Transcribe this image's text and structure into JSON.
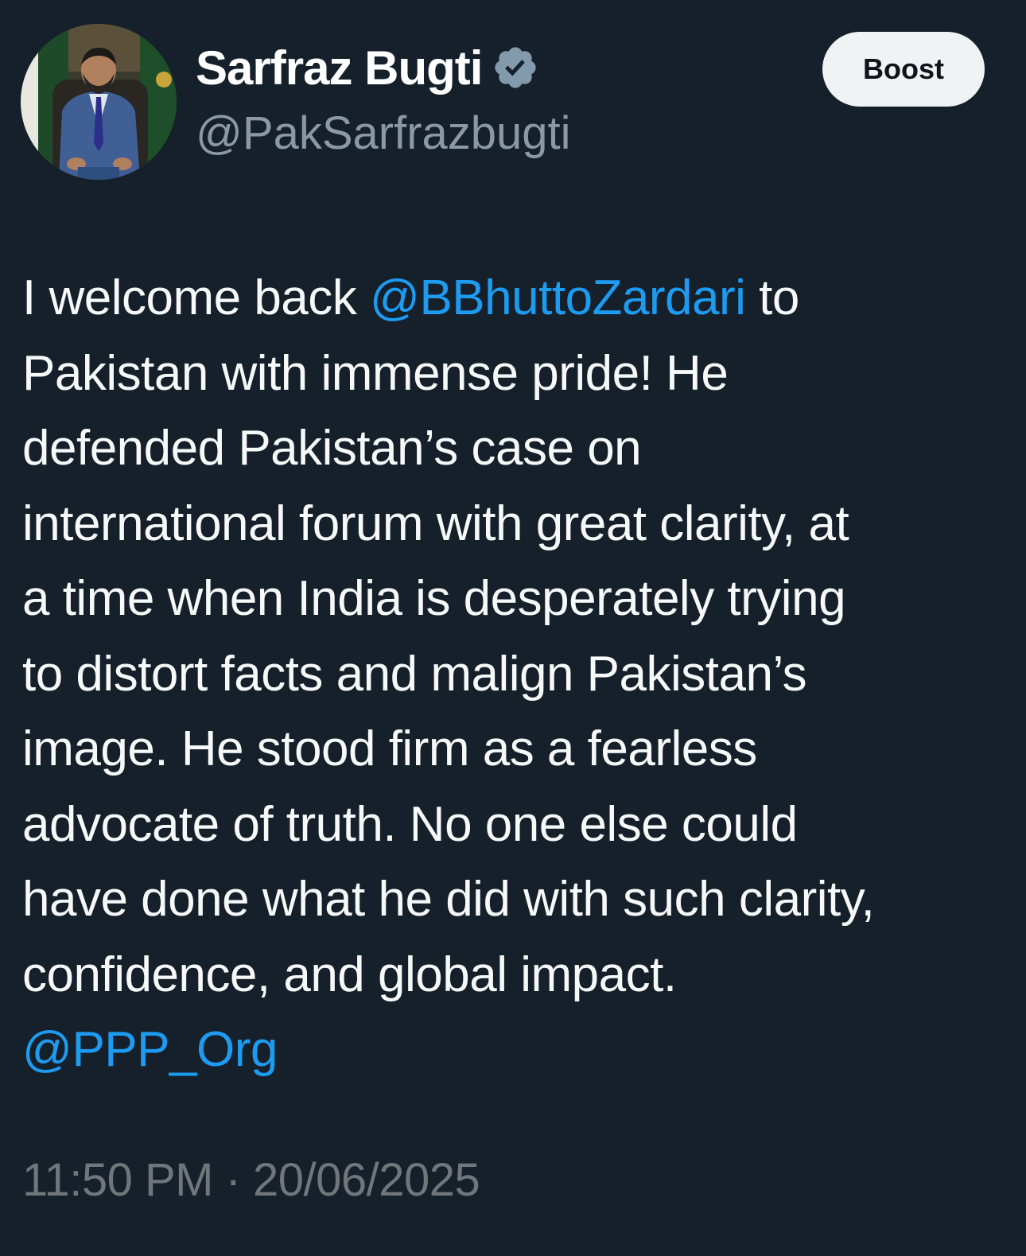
{
  "post": {
    "author": {
      "display_name": "Sarfraz Bugti",
      "handle": "@PakSarfrazbugti",
      "verified": true,
      "verified_icon": "verified-badge-icon"
    },
    "boost_label": "Boost",
    "body": {
      "lines": [
        [
          "I welcome back ",
          "@BBhuttoZardari",
          " to"
        ],
        [
          "Pakistan with immense pride! He"
        ],
        [
          "defended Pakistan’s case on"
        ],
        [
          "international forum with great clarity, at"
        ],
        [
          "a time when India is desperately trying"
        ],
        [
          "to distort facts and malign Pakistan’s"
        ],
        [
          "image. He stood firm as a fearless"
        ],
        [
          "advocate of truth. No one else could"
        ],
        [
          "have done what he did with such clarity,"
        ],
        [
          "confidence, and global impact."
        ],
        [
          "@PPP_Org"
        ]
      ],
      "mentions": [
        "@BBhuttoZardari",
        "@PPP_Org"
      ]
    },
    "timestamp": "11:50 PM · 20/06/2025"
  },
  "colors": {
    "background": "#15202b",
    "text": "#f7f9f9",
    "secondary_text": "#8b98a5",
    "link": "#1d9bf0",
    "button_bg": "#eff3f4",
    "button_text": "#0f1419",
    "verified_badge": "#829aab"
  }
}
